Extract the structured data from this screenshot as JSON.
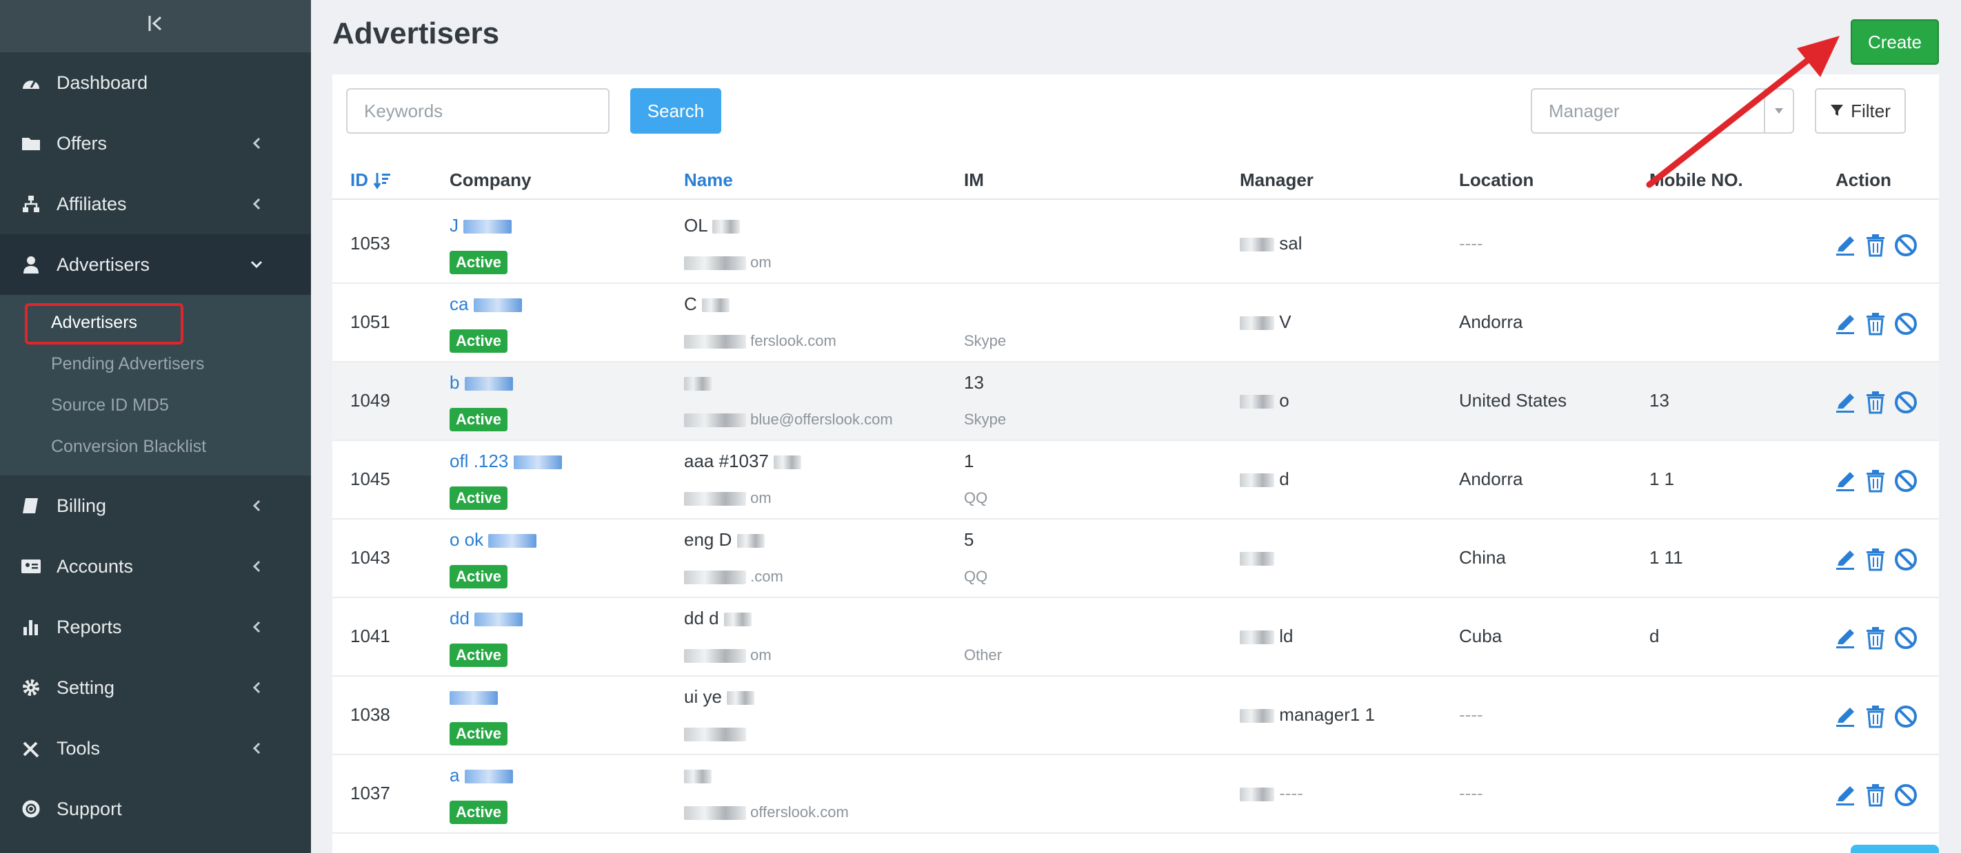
{
  "sidebar": {
    "collapse_glyph": "|‹",
    "items": [
      {
        "label": "Dashboard",
        "icon": "speedometer-icon",
        "has_children": false
      },
      {
        "label": "Offers",
        "icon": "folder-icon",
        "has_children": true
      },
      {
        "label": "Affiliates",
        "icon": "sitemap-icon",
        "has_children": true
      },
      {
        "label": "Advertisers",
        "icon": "user-icon",
        "has_children": true,
        "open": true
      },
      {
        "label": "Billing",
        "icon": "book-icon",
        "has_children": true
      },
      {
        "label": "Accounts",
        "icon": "id-card-icon",
        "has_children": true
      },
      {
        "label": "Reports",
        "icon": "bar-chart-icon",
        "has_children": true
      },
      {
        "label": "Setting",
        "icon": "gear-icon",
        "has_children": true
      },
      {
        "label": "Tools",
        "icon": "tools-icon",
        "has_children": true
      },
      {
        "label": "Support",
        "icon": "lifebuoy-icon",
        "has_children": false
      }
    ],
    "advertisers_submenu": [
      "Advertisers",
      "Pending Advertisers",
      "Source ID MD5",
      "Conversion Blacklist"
    ]
  },
  "page": {
    "title": "Advertisers",
    "create_label": "Create"
  },
  "toolbar": {
    "keywords_placeholder": "Keywords",
    "search_label": "Search",
    "manager_placeholder": "Manager",
    "filter_label": "Filter"
  },
  "table": {
    "headers": {
      "id": "ID",
      "company": "Company",
      "name": "Name",
      "im": "IM",
      "manager": "Manager",
      "location": "Location",
      "mobile": "Mobile NO.",
      "action": "Action"
    },
    "rows": [
      {
        "id": "1053",
        "company": "J",
        "status": "Active",
        "name": "OL",
        "email": "om",
        "im": "",
        "im_type": "",
        "manager": "sal",
        "location": "----",
        "mobile": ""
      },
      {
        "id": "1051",
        "company": "ca",
        "status": "Active",
        "name": "C",
        "email": "ferslook.com",
        "im": "",
        "im_type": "Skype",
        "manager": "V",
        "location": "Andorra",
        "mobile": ""
      },
      {
        "id": "1049",
        "company": "b",
        "status": "Active",
        "name": "",
        "email": "blue@offerslook.com",
        "im": "13",
        "im_type": "Skype",
        "manager": "o",
        "location": "United States",
        "mobile": "13"
      },
      {
        "id": "1045",
        "company": "ofl .123",
        "status": "Active",
        "name": "aaa #1037",
        "email": "om",
        "im": "1",
        "im_type": "QQ",
        "manager": "d",
        "location": "Andorra",
        "mobile": "1 1"
      },
      {
        "id": "1043",
        "company": "o ok",
        "status": "Active",
        "name": "eng D",
        "email": ".com",
        "im": "5",
        "im_type": "QQ",
        "manager": "",
        "location": "China",
        "mobile": "1 11"
      },
      {
        "id": "1041",
        "company": "dd",
        "status": "Active",
        "name": "dd d",
        "email": "om",
        "im": "",
        "im_type": "Other",
        "manager": "ld",
        "location": "Cuba",
        "mobile": "d"
      },
      {
        "id": "1038",
        "company": "",
        "status": "Active",
        "name": "ui ye",
        "email": "",
        "im": "",
        "im_type": "",
        "manager": "manager1 1",
        "location": "----",
        "mobile": ""
      },
      {
        "id": "1037",
        "company": "a",
        "status": "Active",
        "name": "",
        "email": "offerslook.com",
        "im": "",
        "im_type": "",
        "manager": "----",
        "location": "----",
        "mobile": ""
      }
    ]
  },
  "colors": {
    "sidebar_bg": "#2c3b41",
    "accent_blue": "#2a7fd4",
    "create_green": "#28a745",
    "annotation_red": "#e0262a"
  }
}
